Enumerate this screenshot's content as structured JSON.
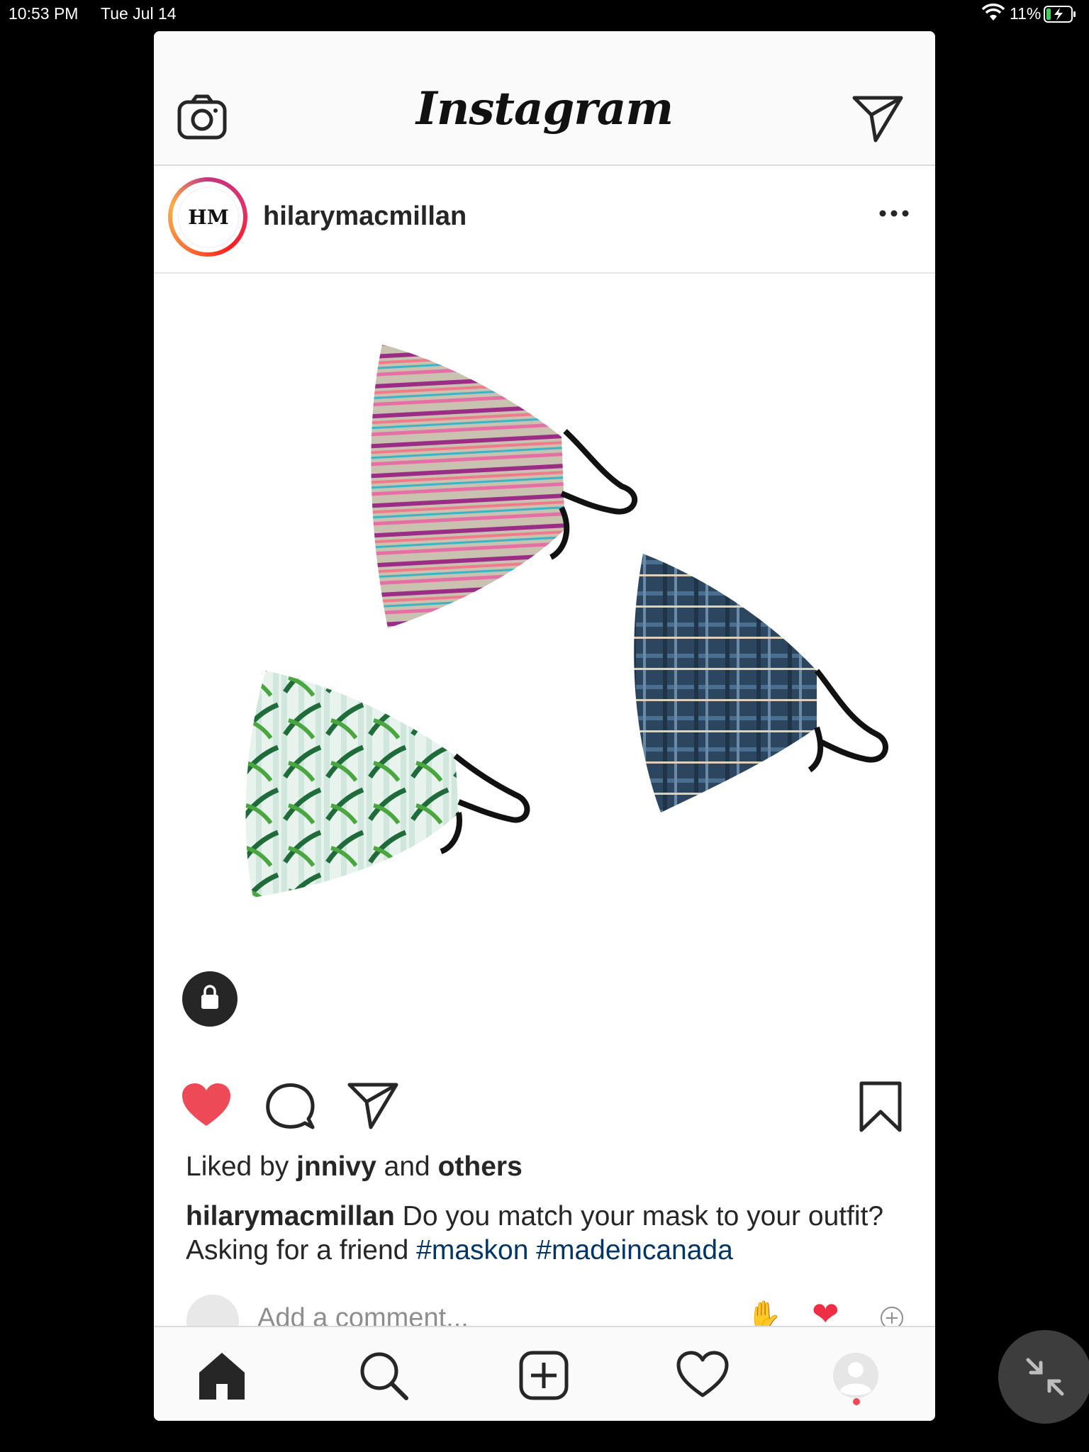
{
  "status_bar": {
    "time": "10:53 PM",
    "date": "Tue Jul 14",
    "battery": "11%"
  },
  "top_bar": {
    "logo": "Instagram"
  },
  "post": {
    "username": "hilarymacmillan",
    "avatar_text": "HM",
    "likes": {
      "prefix": "Liked by",
      "user": "jnnivy",
      "middle": "and",
      "others": "others"
    },
    "caption": {
      "username": "hilarymacmillan",
      "text": "Do you match your mask to your outfit? Asking for a friend",
      "hashtags": [
        "#maskon",
        "#madeincanada"
      ]
    },
    "comment_placeholder": "Add a comment...",
    "quick_reactions": [
      "raising-hands-emoji",
      "heart-emoji"
    ]
  },
  "colors": {
    "like_red": "#ed4956",
    "hashtag_blue": "#003569",
    "text": "#262626"
  },
  "icons": {
    "top_left": "camera-icon",
    "top_right": "direct-message-icon",
    "actions": [
      "heart-icon",
      "comment-icon",
      "share-icon",
      "bookmark-icon"
    ],
    "nav": [
      "home-icon",
      "search-icon",
      "add-post-icon",
      "activity-heart-icon",
      "profile-icon"
    ]
  }
}
